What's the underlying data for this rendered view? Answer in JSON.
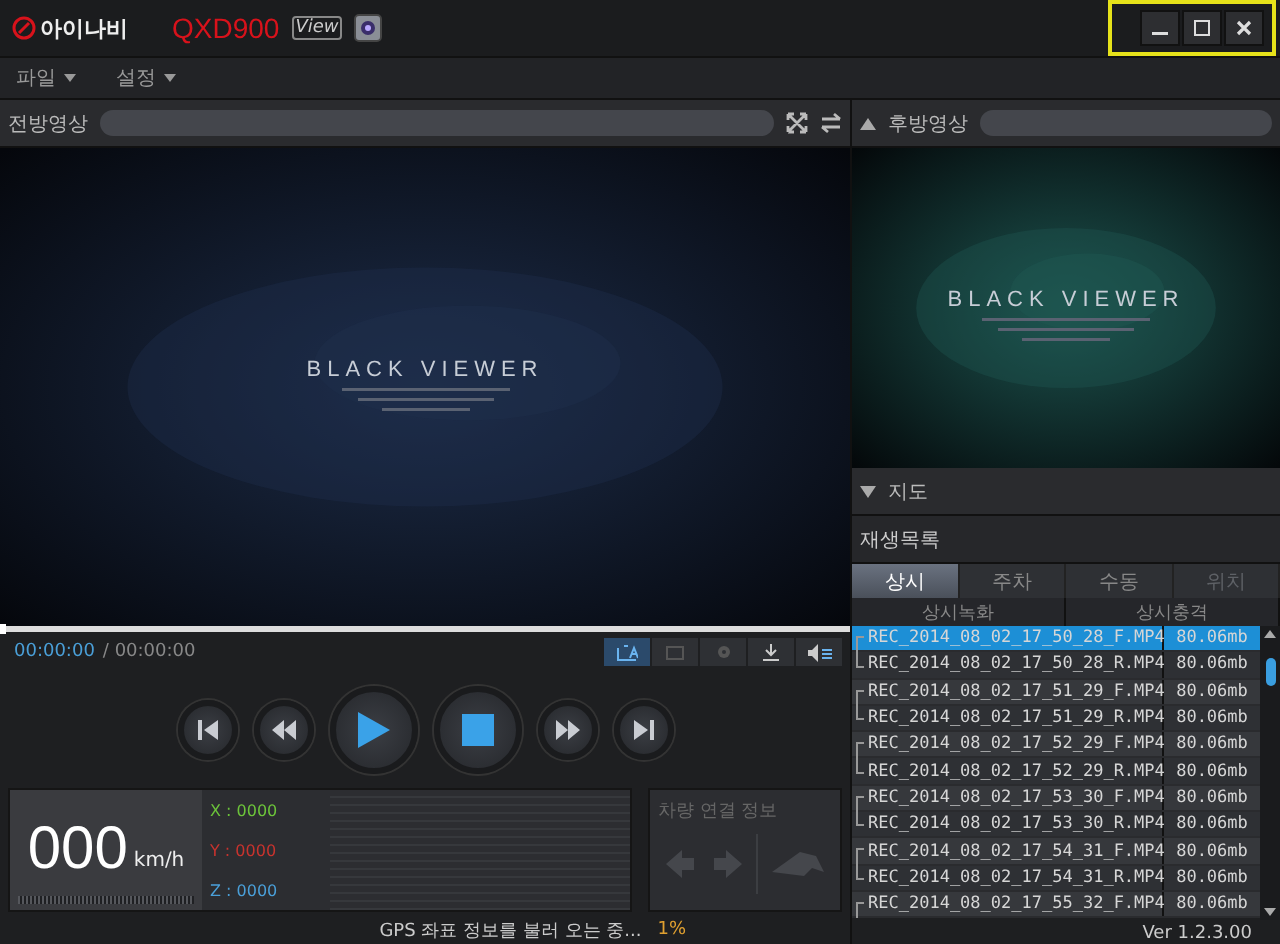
{
  "window": {
    "brand": "아이나비",
    "model": "QXD900",
    "model_badge": "View"
  },
  "menu": [
    {
      "label": "파일"
    },
    {
      "label": "설정"
    }
  ],
  "front_video": {
    "title": "전방영상",
    "logo_text": "BLACK VIEWER"
  },
  "rear_video": {
    "title": "후방영상",
    "logo_text": "BLACK VIEWER"
  },
  "map": {
    "title": "지도"
  },
  "playlist": {
    "title": "재생목록",
    "tabs": [
      {
        "label": "상시",
        "selected": true,
        "disabled": false
      },
      {
        "label": "주차",
        "selected": false,
        "disabled": false
      },
      {
        "label": "수동",
        "selected": false,
        "disabled": false
      },
      {
        "label": "위치",
        "selected": false,
        "disabled": true
      }
    ],
    "columns": [
      "상시녹화",
      "상시충격"
    ],
    "rows": [
      {
        "name": "REC_2014_08_02_17_50_28_F.MP4",
        "size": "80.06mb",
        "kind": "front",
        "selected": true
      },
      {
        "name": "REC_2014_08_02_17_50_28_R.MP4",
        "size": "80.06mb",
        "kind": "rear",
        "selected": false
      },
      {
        "name": "REC_2014_08_02_17_51_29_F.MP4",
        "size": "80.06mb",
        "kind": "front",
        "selected": false
      },
      {
        "name": "REC_2014_08_02_17_51_29_R.MP4",
        "size": "80.06mb",
        "kind": "rear",
        "selected": false
      },
      {
        "name": "REC_2014_08_02_17_52_29_F.MP4",
        "size": "80.06mb",
        "kind": "front",
        "selected": false
      },
      {
        "name": "REC_2014_08_02_17_52_29_R.MP4",
        "size": "80.06mb",
        "kind": "rear",
        "selected": false
      },
      {
        "name": "REC_2014_08_02_17_53_30_F.MP4",
        "size": "80.06mb",
        "kind": "front",
        "selected": false
      },
      {
        "name": "REC_2014_08_02_17_53_30_R.MP4",
        "size": "80.06mb",
        "kind": "rear",
        "selected": false
      },
      {
        "name": "REC_2014_08_02_17_54_31_F.MP4",
        "size": "80.06mb",
        "kind": "front",
        "selected": false
      },
      {
        "name": "REC_2014_08_02_17_54_31_R.MP4",
        "size": "80.06mb",
        "kind": "rear",
        "selected": false
      },
      {
        "name": "REC_2014_08_02_17_55_32_F.MP4",
        "size": "80.06mb",
        "kind": "front",
        "selected": false
      }
    ]
  },
  "seek": {
    "level": 0
  },
  "playback": {
    "elapsed": "00:00:00",
    "total": "/ 00:00:00"
  },
  "speed": {
    "value": "000",
    "unit": "km/h"
  },
  "axes": [
    {
      "label": "X : 0000",
      "color": "#6cc43a"
    },
    {
      "label": "Y : 0000",
      "color": "#c8332e"
    },
    {
      "label": "Z : 0000",
      "color": "#4a9fd8"
    }
  ],
  "vehicle_info": {
    "title": "차량 연결 정보"
  },
  "status": {
    "message": "GPS 좌표 정보를 불러 오는 중...",
    "progress": "1%"
  },
  "version": "Ver 1.2.3.00"
}
